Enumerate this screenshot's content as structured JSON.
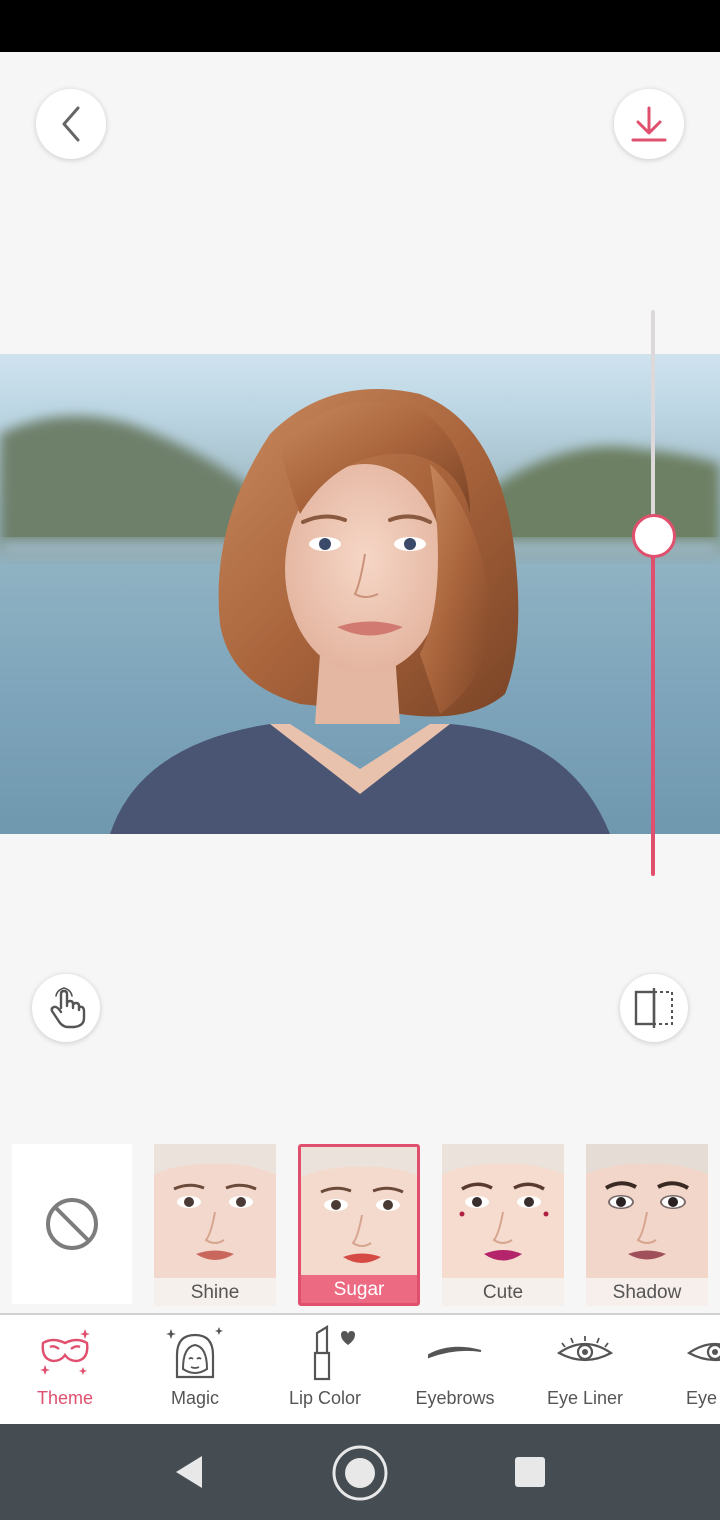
{
  "header": {
    "back_icon": "chevron-left-icon",
    "save_icon": "download-icon"
  },
  "colors": {
    "accent": "#e0506e",
    "background": "#f6f6f6",
    "navbar": "#454d53"
  },
  "slider": {
    "intensity_fraction": 0.6
  },
  "themes": {
    "none_icon": "no-symbol-icon",
    "items": [
      {
        "label": "Shine"
      },
      {
        "label": "Sugar",
        "selected": true
      },
      {
        "label": "Cute"
      },
      {
        "label": "Shadow"
      }
    ]
  },
  "toolbar": {
    "items": [
      {
        "label": "Theme",
        "icon": "mask-icon",
        "active": true
      },
      {
        "label": "Magic",
        "icon": "sparkle-face-icon"
      },
      {
        "label": "Lip Color",
        "icon": "lipstick-icon"
      },
      {
        "label": "Eyebrows",
        "icon": "eyebrow-icon"
      },
      {
        "label": "Eye Liner",
        "icon": "eye-icon"
      },
      {
        "label": "Eye Sh",
        "icon": "eye-icon"
      }
    ]
  },
  "navbar": {
    "back_icon": "triangle-back-icon",
    "home_icon": "circle-home-icon",
    "recents_icon": "square-recents-icon"
  }
}
